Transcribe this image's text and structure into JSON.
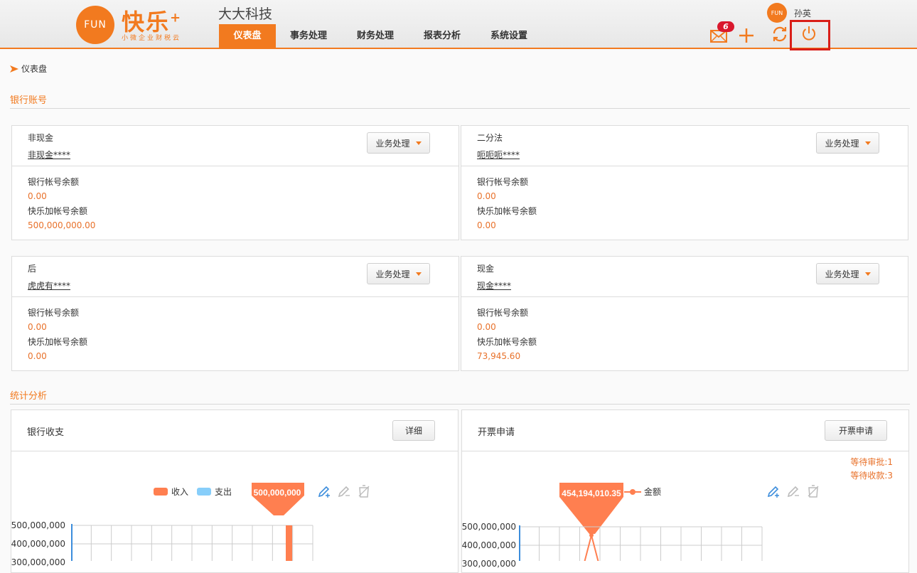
{
  "header": {
    "logo_mark": "FUN",
    "logo_text": "快乐",
    "logo_plus": "+",
    "logo_subtitle": "小微企业财税云",
    "company": "大大科技",
    "user_avatar": "FUN",
    "username": "孙英",
    "mail_badge": "6",
    "accent": "#f27a1f",
    "nav": [
      {
        "label": "仪表盘",
        "active": true
      },
      {
        "label": "事务处理",
        "active": false
      },
      {
        "label": "财务处理",
        "active": false
      },
      {
        "label": "报表分析",
        "active": false
      },
      {
        "label": "系统设置",
        "active": false
      }
    ],
    "icons": [
      "mail-icon",
      "plus-icon",
      "refresh-icon",
      "power-icon"
    ]
  },
  "breadcrumb": {
    "current": "仪表盘"
  },
  "bank_section": {
    "title": "银行账号",
    "accounts": [
      {
        "name": "非现金",
        "account": "非现金****",
        "action": "业务处理",
        "bank_balance_label": "银行帐号余额",
        "bank_balance": "0.00",
        "fun_balance_label": "快乐加帐号余额",
        "fun_balance": "500,000,000.00"
      },
      {
        "name": "二分法",
        "account": "呃呃呃****",
        "action": "业务处理",
        "bank_balance_label": "银行帐号余额",
        "bank_balance": "0.00",
        "fun_balance_label": "快乐加帐号余额",
        "fun_balance": "0.00"
      },
      {
        "name": "后",
        "account": "虎虎有****",
        "action": "业务处理",
        "bank_balance_label": "银行帐号余额",
        "bank_balance": "0.00",
        "fun_balance_label": "快乐加帐号余额",
        "fun_balance": "0.00"
      },
      {
        "name": "现金",
        "account": "现金****",
        "action": "业务处理",
        "bank_balance_label": "银行帐号余额",
        "bank_balance": "0.00",
        "fun_balance_label": "快乐加帐号余额",
        "fun_balance": "73,945.60"
      }
    ]
  },
  "stats_section": {
    "title": "统计分析",
    "bank_panel": {
      "title": "银行收支",
      "button": "详细",
      "legend": [
        {
          "name": "收入",
          "color": "#ff7f50"
        },
        {
          "name": "支出",
          "color": "#87cefa"
        }
      ],
      "tooltip": "500,000,000",
      "yticks": [
        "500,000,000",
        "400,000,000",
        "300,000,000"
      ]
    },
    "invoice_panel": {
      "title": "开票申请",
      "button": "开票申请",
      "waiting_approval": "等待审批:1",
      "waiting_payment": "等待收款:3",
      "legend": [
        {
          "name": "金额",
          "color": "#ff7f50"
        }
      ],
      "tooltip": "454,194,010.35",
      "yticks": [
        "500,000,000",
        "400,000,000",
        "300,000,000"
      ]
    }
  },
  "chart_data": [
    {
      "type": "bar",
      "title": "银行收支",
      "series": [
        {
          "name": "收入",
          "values": [
            500000000
          ]
        },
        {
          "name": "支出",
          "values": []
        }
      ],
      "ylim": [
        0,
        500000000
      ],
      "yticks": [
        500000000,
        400000000,
        300000000
      ],
      "legend": "top-center",
      "grid": true
    },
    {
      "type": "line",
      "title": "开票申请",
      "series": [
        {
          "name": "金额",
          "values": [
            454194010.35
          ]
        }
      ],
      "ylim": [
        0,
        500000000
      ],
      "yticks": [
        500000000,
        400000000,
        300000000
      ],
      "legend": "top-center",
      "grid": true
    }
  ]
}
